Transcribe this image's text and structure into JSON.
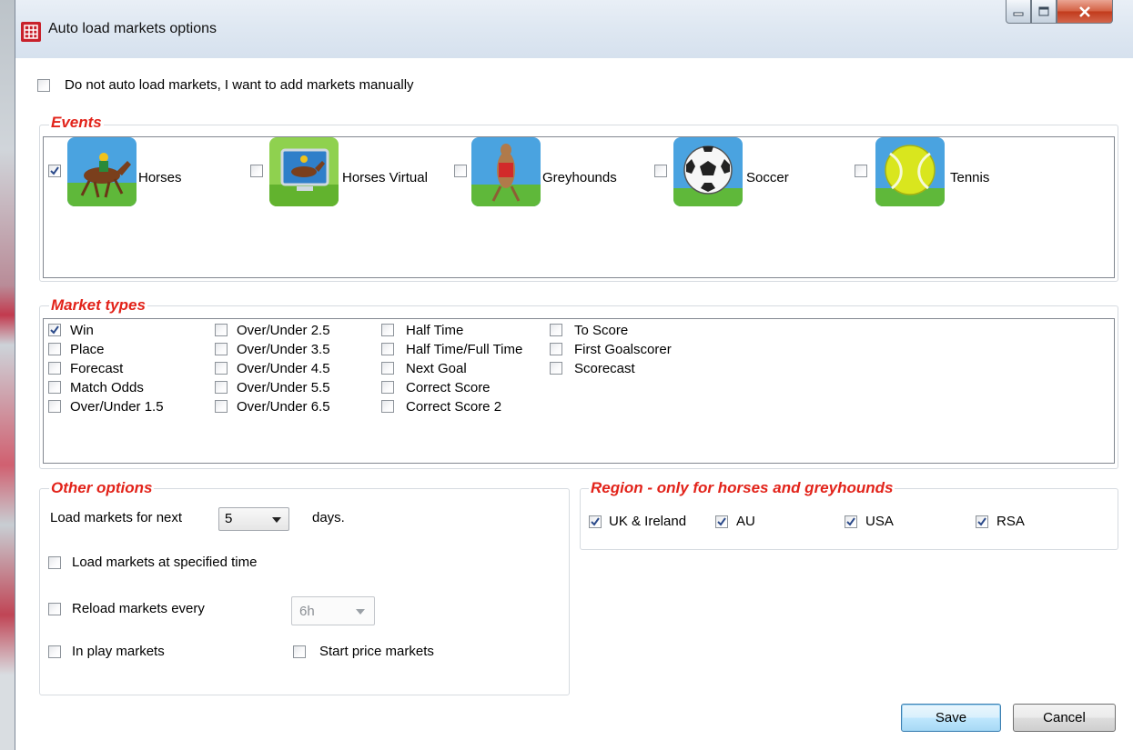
{
  "window": {
    "title": "Auto load markets options"
  },
  "manual_option": {
    "label": "Do not auto load markets, I want to add markets manually",
    "checked": false
  },
  "events": {
    "title": "Events",
    "items": [
      {
        "label": "Horses",
        "icon": "horse-racing-icon",
        "checked": true
      },
      {
        "label": "Horses Virtual",
        "icon": "virtual-horse-racing-icon",
        "checked": false
      },
      {
        "label": "Greyhounds",
        "icon": "greyhound-icon",
        "checked": false
      },
      {
        "label": "Soccer",
        "icon": "soccer-ball-icon",
        "checked": false
      },
      {
        "label": "Tennis",
        "icon": "tennis-ball-icon",
        "checked": false
      }
    ]
  },
  "market_types": {
    "title": "Market types",
    "columns": [
      [
        {
          "label": "Win",
          "checked": true
        },
        {
          "label": "Place",
          "checked": false
        },
        {
          "label": "Forecast",
          "checked": false
        },
        {
          "label": "Match Odds",
          "checked": false
        },
        {
          "label": "Over/Under 1.5",
          "checked": false
        }
      ],
      [
        {
          "label": "Over/Under 2.5",
          "checked": false
        },
        {
          "label": "Over/Under 3.5",
          "checked": false
        },
        {
          "label": "Over/Under 4.5",
          "checked": false
        },
        {
          "label": "Over/Under 5.5",
          "checked": false
        },
        {
          "label": "Over/Under 6.5",
          "checked": false
        }
      ],
      [
        {
          "label": "Half Time",
          "checked": false
        },
        {
          "label": "Half Time/Full Time",
          "checked": false
        },
        {
          "label": "Next Goal",
          "checked": false
        },
        {
          "label": "Correct Score",
          "checked": false
        },
        {
          "label": "Correct Score 2",
          "checked": false
        }
      ],
      [
        {
          "label": "To Score",
          "checked": false
        },
        {
          "label": "First Goalscorer",
          "checked": false
        },
        {
          "label": "Scorecast",
          "checked": false
        }
      ]
    ]
  },
  "other_options": {
    "title": "Other options",
    "load_for_label": "Load markets for next",
    "days_value": "5",
    "days_suffix": "days.",
    "specified_time": {
      "label": "Load markets at specified time",
      "checked": false
    },
    "reload_every": {
      "label": "Reload markets every",
      "checked": false,
      "value": "6h"
    },
    "in_play": {
      "label": "In play markets",
      "checked": false
    },
    "start_price": {
      "label": "Start price markets",
      "checked": false
    }
  },
  "region": {
    "title": "Region - only for horses and greyhounds",
    "items": [
      {
        "label": "UK & Ireland",
        "checked": true
      },
      {
        "label": "AU",
        "checked": true
      },
      {
        "label": "USA",
        "checked": true
      },
      {
        "label": "RSA",
        "checked": true
      }
    ]
  },
  "buttons": {
    "save": "Save",
    "cancel": "Cancel"
  },
  "colors": {
    "group_title": "#e2231a",
    "title_bar": "#dfe8f2",
    "close_button": "#c23b1c",
    "default_button": "#3c7fb1"
  }
}
